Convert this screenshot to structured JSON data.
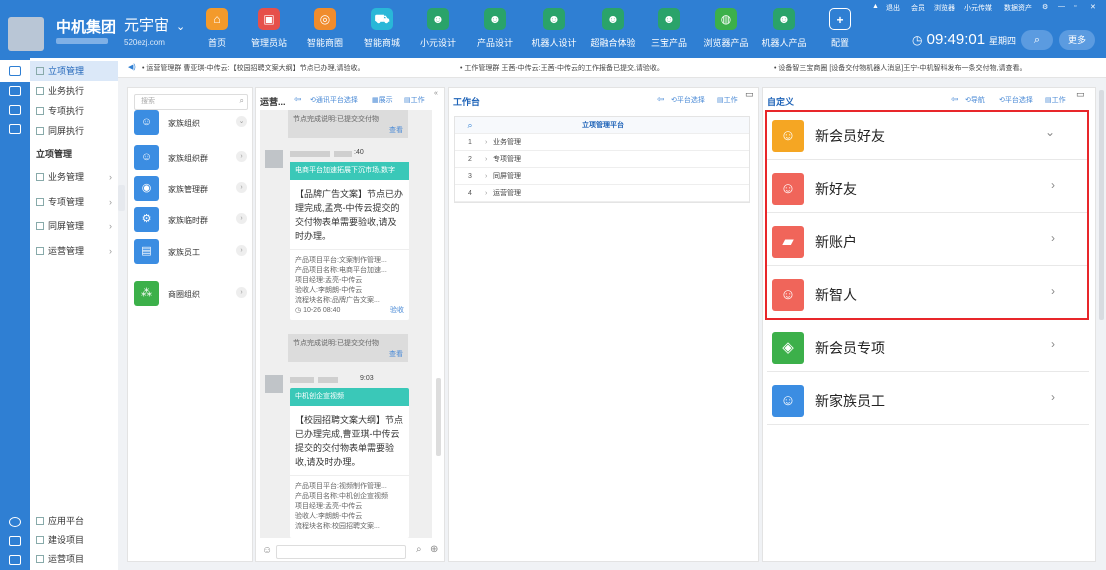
{
  "header": {
    "group_name": "中机集团",
    "brand": "元宇宙",
    "domain": "520ezj.com",
    "nav": [
      {
        "label": "首页",
        "icon": "home-icon",
        "color": "#f39a2b",
        "glyph": "⌂"
      },
      {
        "label": "管理员站",
        "icon": "admin-station-icon",
        "color": "#e6504a",
        "glyph": "▣"
      },
      {
        "label": "智能商圈",
        "icon": "smart-mall-icon",
        "color": "#f08c2c",
        "glyph": "◎"
      },
      {
        "label": "智能商城",
        "icon": "shopping-cart-icon",
        "color": "#29b7d8",
        "glyph": "⛟"
      },
      {
        "label": "小元设计",
        "icon": "robot-icon",
        "color": "#2aa36a",
        "glyph": "☻"
      },
      {
        "label": "产品设计",
        "icon": "robot-icon",
        "color": "#2aa36a",
        "glyph": "☻"
      },
      {
        "label": "机器人设计",
        "icon": "robot-icon",
        "color": "#2aa36a",
        "glyph": "☻"
      },
      {
        "label": "超融合体验",
        "icon": "robot-icon",
        "color": "#2aa36a",
        "glyph": "☻"
      },
      {
        "label": "三宝产品",
        "icon": "robot-icon",
        "color": "#2aa36a",
        "glyph": "☻"
      },
      {
        "label": "浏览器产品",
        "icon": "browser-icon",
        "color": "#3cb04a",
        "glyph": "◍"
      },
      {
        "label": "机器人产品",
        "icon": "robot-icon",
        "color": "#2aa36a",
        "glyph": "☻"
      },
      {
        "label": "配置",
        "icon": "plus-icon",
        "color": "#2f7fd3",
        "glyph": "+"
      }
    ],
    "top_links": [
      "退出",
      "会员",
      "浏览器",
      "小元传媒",
      "数据资产"
    ],
    "time": "09:49:01",
    "weekday": "星期四",
    "more_label": "更多"
  },
  "left_menu": {
    "items": [
      {
        "label": "立项管理",
        "selected": true
      },
      {
        "label": "业务执行"
      },
      {
        "label": "专项执行"
      },
      {
        "label": "同屏执行"
      },
      {
        "label": "立项管理",
        "section": true
      },
      {
        "label": "业务管理"
      },
      {
        "label": "专项管理"
      },
      {
        "label": "同屏管理"
      },
      {
        "label": "运营管理"
      }
    ],
    "bottom_items": [
      "应用平台",
      "建设项目",
      "运营项目"
    ]
  },
  "ticker": [
    "• 运营管理群 曹亚琪-中传云:【校园招聘文案大纲】节点已办理,请验收。",
    "• 工作管理群 王茜-中传云:王茜-中传云的工作报备已提交,请验收。",
    "• 设备智三宝商圈 [设备交付物机器人消息]王宁-中机智科发布一条交付物,请查看。"
  ],
  "family_panel": {
    "search_placeholder": "搜索",
    "items": [
      {
        "label": "家族组织",
        "color": "#3b8de2",
        "glyph": "☺"
      },
      {
        "label": "家族组织群",
        "color": "#3b8de2",
        "glyph": "☺"
      },
      {
        "label": "家族管理群",
        "color": "#3b8de2",
        "glyph": "◉"
      },
      {
        "label": "家族临时群",
        "color": "#3b8de2",
        "glyph": "⚙"
      },
      {
        "label": "家族员工",
        "color": "#3b8de2",
        "glyph": "▤"
      },
      {
        "label": "商圈组织",
        "color": "#3cb04a",
        "glyph": "⁂"
      }
    ]
  },
  "chat_panel": {
    "title": "运营...",
    "tools": [
      "通讯平台选择",
      "展示",
      "工作"
    ],
    "note_text": "节点完成说明:已提交交付物",
    "note_check": "查看",
    "msg1": {
      "time": ":40",
      "header": "电商平台加速拓展下沉市场,数字",
      "body": "【品牌广告文案】节点已办理完成,孟亮-中传云提交的交付物表单需要验收,请及时办理。",
      "details": [
        "产品项目平台:文案制作管理...",
        "产品项目名称:电商平台加速...",
        "项目经理:孟亮-中传云",
        "验收人:李朗朗-中传云",
        "流程块名称:品牌广告文案..."
      ],
      "stamp": "10-26 08:40",
      "accept": "验收"
    },
    "msg2": {
      "time": "9:03",
      "header": "中机创企宣视频",
      "body": "【校园招聘文案大纲】节点已办理完成,曹亚琪-中传云提交的交付物表单需要验收,请及时办理。",
      "details": [
        "产品项目平台:视频制作管理...",
        "产品项目名称:中机创企宣视频",
        "项目经理:孟亮-中传云",
        "验收人:李朗朗-中传云",
        "流程块名称:校园招聘文案..."
      ]
    }
  },
  "workbench": {
    "title": "工作台",
    "tools": [
      "平台选择",
      "工作"
    ],
    "table_header": "立项管理平台",
    "rows": [
      {
        "no": "1",
        "label": "业务管理"
      },
      {
        "no": "2",
        "label": "专项管理"
      },
      {
        "no": "3",
        "label": "同屏管理"
      },
      {
        "no": "4",
        "label": "运营管理"
      }
    ]
  },
  "custom": {
    "title": "自定义",
    "tools": [
      "导航",
      "平台选择",
      "工作"
    ],
    "cards": [
      {
        "label": "新会员好友",
        "color": "#f5a623",
        "glyph": "☺",
        "arrow": "⌄"
      },
      {
        "label": "新好友",
        "color": "#f0655a",
        "glyph": "☺",
        "arrow": "›"
      },
      {
        "label": "新账户",
        "color": "#f0655a",
        "glyph": "▰",
        "arrow": "›"
      },
      {
        "label": "新智人",
        "color": "#f0655a",
        "glyph": "☺",
        "arrow": "›"
      },
      {
        "label": "新会员专项",
        "color": "#3cb04a",
        "glyph": "◈",
        "arrow": "›"
      },
      {
        "label": "新家族员工",
        "color": "#3b8de2",
        "glyph": "☺",
        "arrow": "›"
      }
    ]
  }
}
